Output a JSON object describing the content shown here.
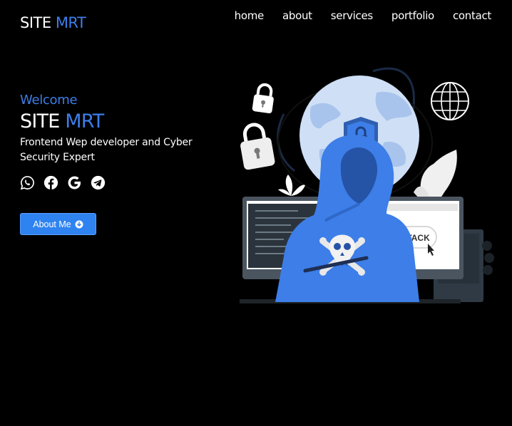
{
  "header": {
    "logo_part1": "SITE",
    "logo_part2": "MRT",
    "nav": [
      "home",
      "about",
      "services",
      "portfolio",
      "contact"
    ]
  },
  "hero": {
    "welcome": "Welcome",
    "title_part1": "SITE",
    "title_part2": "MRT",
    "description": "Frontend Wep developer and Cyber Security Expert",
    "socials": [
      "whatsapp-icon",
      "facebook-icon",
      "google-icon",
      "telegram-icon"
    ],
    "button_label": "About Me"
  },
  "illustration": {
    "screen_label": "ATTACK"
  },
  "colors": {
    "accent": "#3d7ee8",
    "button": "#2f83f0",
    "background": "#000000"
  }
}
